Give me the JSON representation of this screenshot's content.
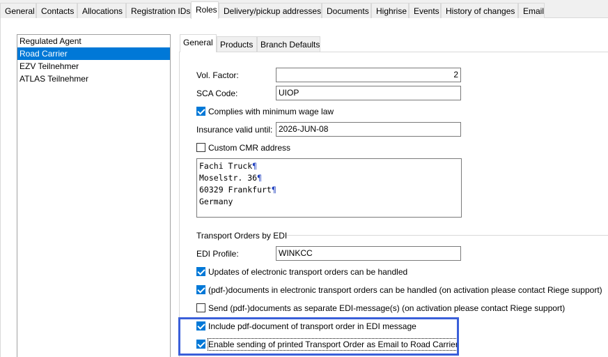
{
  "top_tabs": [
    "General",
    "Contacts",
    "Allocations",
    "Registration IDs",
    "Roles",
    "Delivery/pickup addresses",
    "Documents",
    "Highrise",
    "Events",
    "History of changes",
    "Email"
  ],
  "active_top_tab": "Roles",
  "roles": [
    "Regulated Agent",
    "Road Carrier",
    "EZV Teilnehmer",
    "ATLAS Teilnehmer"
  ],
  "selected_role": "Road Carrier",
  "inner_tabs": [
    "General",
    "Products",
    "Branch Defaults"
  ],
  "active_inner_tab": "General",
  "form": {
    "vol_factor_label": "Vol. Factor:",
    "vol_factor_value": "2",
    "sca_code_label": "SCA Code:",
    "sca_code_value": "UIOP",
    "min_wage_label": "Complies with minimum wage law",
    "min_wage_checked": true,
    "insurance_label": "Insurance valid until:",
    "insurance_value": "2026-JUN-08",
    "custom_cmr_label": "Custom CMR address",
    "custom_cmr_checked": false,
    "cmr_address": [
      "Fachi Truck",
      "Moselstr. 36",
      "60329 Frankfurt",
      "Germany"
    ],
    "edi_group_label": "Transport Orders by EDI",
    "edi_profile_label": "EDI Profile:",
    "edi_profile_value": "WINKCC",
    "opt_updates": "Updates of electronic transport orders can be handled",
    "opt_pdf_docs": "(pdf-)documents in electronic transport orders can be handled (on activation please contact Riege support)",
    "opt_send_pdf": "Send (pdf-)documents as separate EDI-message(s) (on activation please contact Riege support)",
    "opt_include_pdf": "Include pdf-document of transport order in EDI message",
    "opt_enable_email": "Enable sending of printed Transport Order as Email to Road Carrier"
  },
  "colors": {
    "selection": "#0078d7",
    "highlight_border": "#3a5fd9",
    "pilcrow": "#1f3fbf"
  },
  "icons": {
    "checkbox": "check-icon",
    "pilcrow": "pilcrow-icon"
  }
}
